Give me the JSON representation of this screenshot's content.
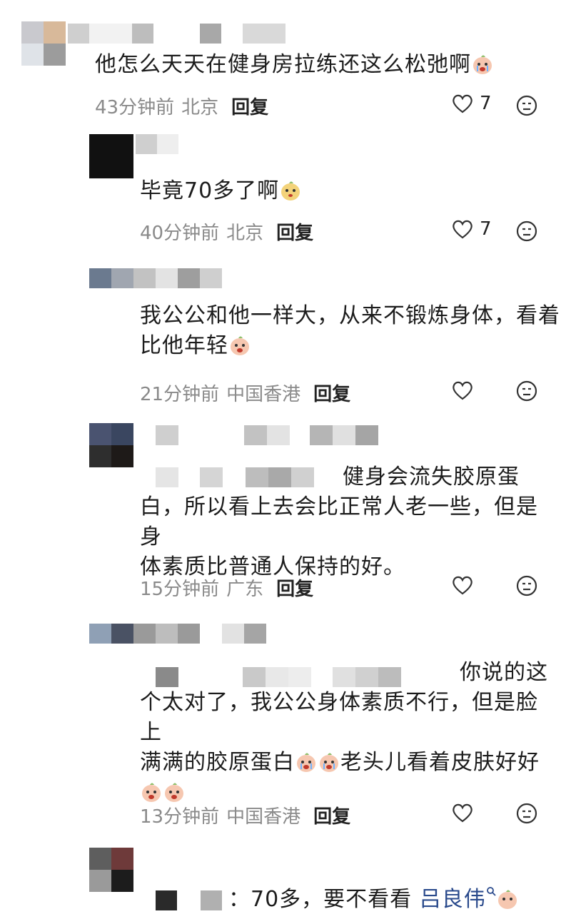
{
  "comments": [
    {
      "text": "他怎么天天在健身房拉练还这么松弛啊",
      "time": "43分钟前",
      "location": "北京",
      "reply": "回复",
      "likes": "7"
    },
    {
      "text": "毕竟70多了啊",
      "time": "40分钟前",
      "location": "北京",
      "reply": "回复",
      "likes": "7"
    },
    {
      "text_line1": "我公公和他一样大，从来不锻炼身体，看着",
      "text_line2": "比他年轻",
      "time": "21分钟前",
      "location": "中国香港",
      "reply": "回复"
    },
    {
      "text_line1": "健身会流失胶原蛋",
      "text_line2": "白，所以看上去会比正常人老一些，但是身",
      "text_line3": "体素质比普通人保持的好。",
      "time": "15分钟前",
      "location": "广东",
      "reply": "回复"
    },
    {
      "text_line1": "你说的这",
      "text_line2": "个太对了，我公公身体素质不行，但是脸上",
      "text_line3a": "满满的胶原蛋白",
      "text_line3b": "老头儿看着皮肤好好",
      "time": "13分钟前",
      "location": "中国香港",
      "reply": "回复"
    },
    {
      "text_a": "：70多，要不看看 ",
      "mention": "吕良伟",
      "mention_icon": "search-icon"
    }
  ],
  "colors": {
    "meta_gray": "#8a8a8a",
    "mention_blue": "#2a4a8c"
  }
}
